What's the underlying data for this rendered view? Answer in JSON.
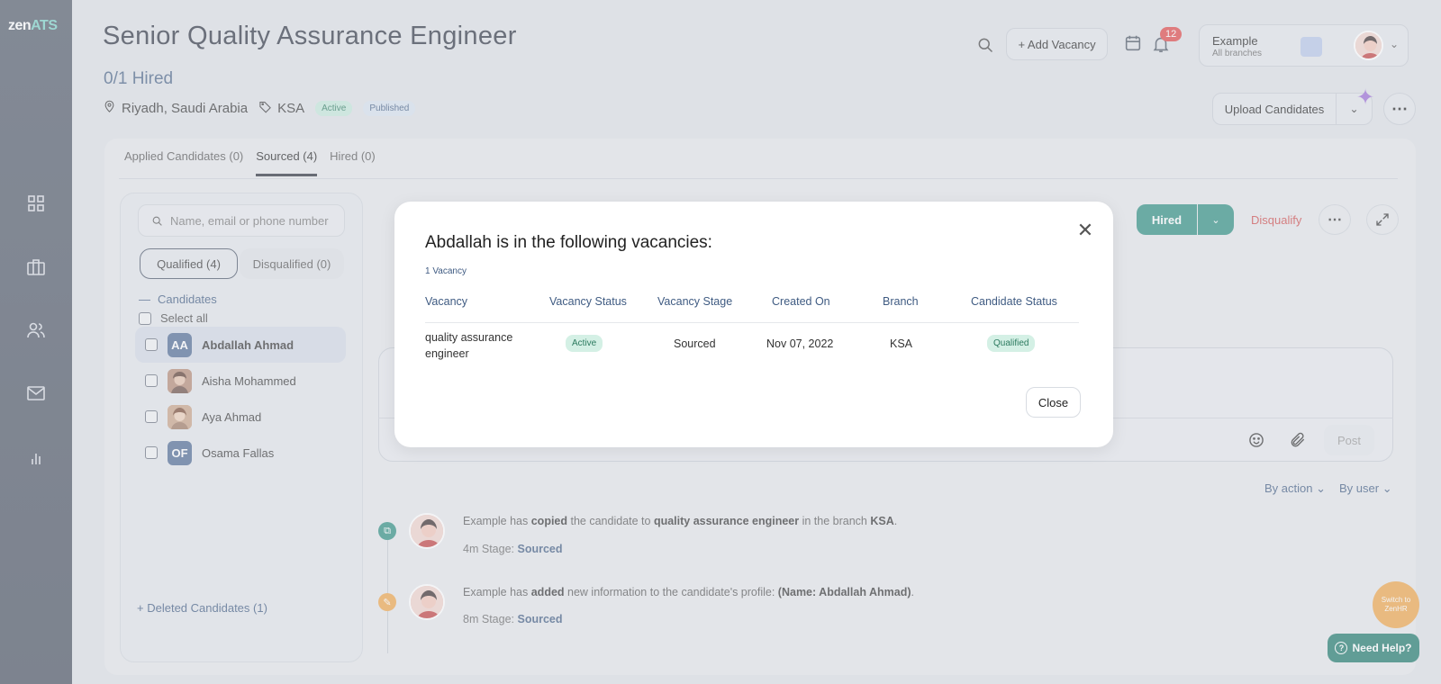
{
  "app": {
    "logo_main": "zen",
    "logo_accent": "ATS"
  },
  "header": {
    "title": "Senior Quality Assurance Engineer",
    "hired_count": "0/1 Hired",
    "location": "Riyadh, Saudi Arabia",
    "branch_tag": "KSA",
    "status_active": "Active",
    "status_published": "Published",
    "add_vacancy": "+ Add Vacancy",
    "notification_count": "12",
    "user_name": "Example",
    "user_scope": "All branches",
    "upload_candidates": "Upload Candidates"
  },
  "tabs": [
    {
      "label": "Applied Candidates (0)"
    },
    {
      "label": "Sourced (4)"
    },
    {
      "label": "Hired (0)"
    }
  ],
  "left": {
    "search_placeholder": "Name, email or phone number",
    "qualified": "Qualified (4)",
    "disqualified": "Disqualified (0)",
    "candidates_heading": "Candidates",
    "select_all": "Select all",
    "candidates": [
      {
        "initials": "AA",
        "name": "Abdallah Ahmad"
      },
      {
        "initials": "",
        "name": "Aisha Mohammed"
      },
      {
        "initials": "",
        "name": "Aya Ahmad"
      },
      {
        "initials": "OF",
        "name": "Osama Fallas"
      }
    ],
    "deleted": "Deleted Candidates (1)"
  },
  "actions": {
    "hired": "Hired",
    "disqualify": "Disqualify",
    "post": "Post",
    "by_action": "By action",
    "by_user": "By user"
  },
  "timeline": [
    {
      "pre": "Example has ",
      "verb": "copied",
      "mid": " the candidate to ",
      "obj": "quality assurance engineer",
      "mid2": " in the branch ",
      "obj2": "KSA",
      "end": ".",
      "time": "4m",
      "stage_label": "Stage:",
      "stage": "Sourced"
    },
    {
      "pre": "Example has ",
      "verb": "added",
      "mid": " new information to the candidate's profile: ",
      "obj": "(Name: Abdallah Ahmad)",
      "mid2": "",
      "obj2": "",
      "end": ".",
      "time": "8m",
      "stage_label": "Stage:",
      "stage": "Sourced"
    }
  ],
  "floating": {
    "switch": "Switch to ZenHR",
    "help": "Need Help?"
  },
  "modal": {
    "title": "Abdallah is in the following vacancies:",
    "count": "1 Vacancy",
    "headers": [
      "Vacancy",
      "Vacancy Status",
      "Vacancy Stage",
      "Created On",
      "Branch",
      "Candidate Status"
    ],
    "row": {
      "vacancy": "quality assurance engineer",
      "status": "Active",
      "stage": "Sourced",
      "created": "Nov 07, 2022",
      "branch": "KSA",
      "candidate_status": "Qualified"
    },
    "close": "Close"
  },
  "colors": {
    "accent": "#2f8f82",
    "danger": "#d04b4b",
    "link": "#3f5b82",
    "orange": "#f0a64b"
  }
}
